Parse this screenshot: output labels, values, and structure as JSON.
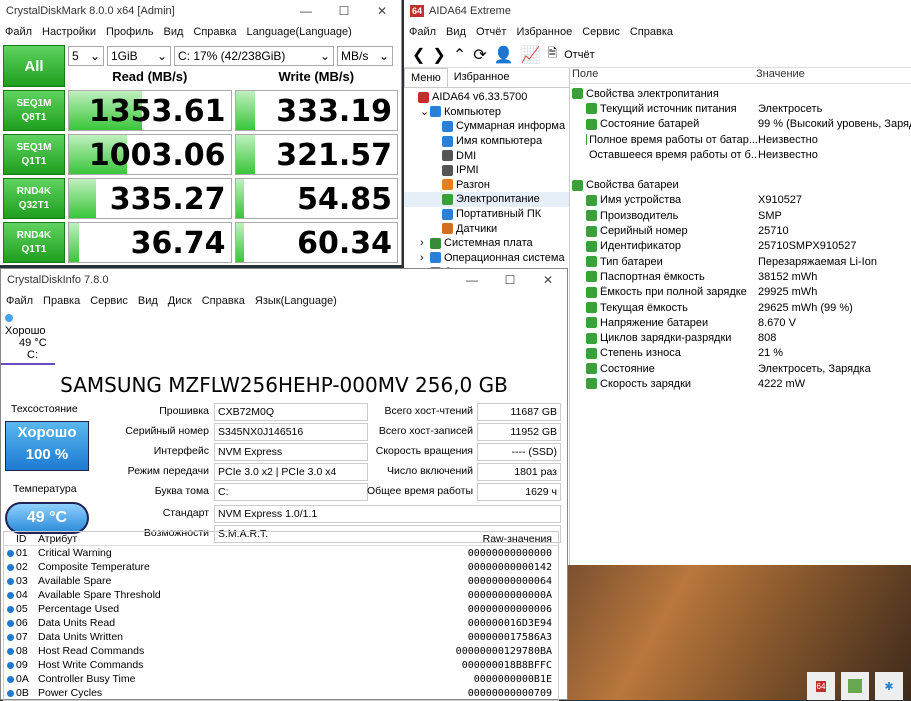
{
  "cdm": {
    "title": "CrystalDiskMark 8.0.0 x64 [Admin]",
    "menu": [
      "Файл",
      "Настройки",
      "Профиль",
      "Вид",
      "Справка",
      "Language(Language)"
    ],
    "all_label": "All",
    "count": "5",
    "size": "1GiB",
    "drive": "C: 17% (42/238GiB)",
    "unit": "MB/s",
    "read_header": "Read (MB/s)",
    "write_header": "Write (MB/s)",
    "tests": [
      {
        "l1": "SEQ1M",
        "l2": "Q8T1",
        "read": "1353.61",
        "write": "333.19",
        "read_fill": 0.45,
        "write_fill": 0.12
      },
      {
        "l1": "SEQ1M",
        "l2": "Q1T1",
        "read": "1003.06",
        "write": "321.57",
        "read_fill": 0.36,
        "write_fill": 0.12
      },
      {
        "l1": "RND4K",
        "l2": "Q32T1",
        "read": "335.27",
        "write": "54.85",
        "read_fill": 0.17,
        "write_fill": 0.05
      },
      {
        "l1": "RND4K",
        "l2": "Q1T1",
        "read": "36.74",
        "write": "60.34",
        "read_fill": 0.06,
        "write_fill": 0.05
      }
    ]
  },
  "aida": {
    "title": "AIDA64 Extreme",
    "menu": [
      "Файл",
      "Вид",
      "Отчёт",
      "Избранное",
      "Сервис",
      "Справка"
    ],
    "report_label": "Отчёт",
    "tabs": [
      "Меню",
      "Избранное"
    ],
    "tree": [
      {
        "label": "AIDA64 v6.33.5700",
        "indent": 0,
        "color": "#c0302a"
      },
      {
        "label": "Компьютер",
        "indent": 1,
        "color": "#2b7fd4"
      },
      {
        "label": "Суммарная информа",
        "indent": 2,
        "color": "#2b7fd4"
      },
      {
        "label": "Имя компьютера",
        "indent": 2,
        "color": "#2b7fd4"
      },
      {
        "label": "DMI",
        "indent": 2,
        "color": "#555"
      },
      {
        "label": "IPMI",
        "indent": 2,
        "color": "#555"
      },
      {
        "label": "Разгон",
        "indent": 2,
        "color": "#e08020"
      },
      {
        "label": "Электропитание",
        "indent": 2,
        "color": "#3aa03a"
      },
      {
        "label": "Портативный ПК",
        "indent": 2,
        "color": "#2b7fd4"
      },
      {
        "label": "Датчики",
        "indent": 2,
        "color": "#d07020"
      },
      {
        "label": "Системная плата",
        "indent": 1,
        "color": "#3a8a3a"
      },
      {
        "label": "Операционная система",
        "indent": 1,
        "color": "#2b7fd4"
      },
      {
        "label": "Сервер",
        "indent": 1,
        "color": "#777"
      }
    ],
    "col_field": "Поле",
    "col_value": "Значение",
    "power_section": "Свойства электропитания",
    "power_rows": [
      {
        "f": "Текущий источник питания",
        "v": "Электросеть"
      },
      {
        "f": "Состояние батарей",
        "v": "99 % (Высокий уровень, Зарядк"
      },
      {
        "f": "Полное время работы от батар...",
        "v": "Неизвестно"
      },
      {
        "f": "Оставшееся время работы от б...",
        "v": "Неизвестно"
      }
    ],
    "battery_section": "Свойства батареи",
    "battery_rows": [
      {
        "f": "Имя устройства",
        "v": "X910527"
      },
      {
        "f": "Производитель",
        "v": "SMP"
      },
      {
        "f": "Серийный номер",
        "v": "25710"
      },
      {
        "f": "Идентификатор",
        "v": "25710SMPX910527"
      },
      {
        "f": "Тип батареи",
        "v": "Перезаряжаемая Li-Ion"
      },
      {
        "f": "Паспортная ёмкость",
        "v": "38152 mWh"
      },
      {
        "f": "Ёмкость при полной зарядке",
        "v": "29925 mWh"
      },
      {
        "f": "Текущая ёмкость",
        "v": "29625 mWh  (99 %)"
      },
      {
        "f": "Напряжение батареи",
        "v": "8.670 V"
      },
      {
        "f": "Циклов зарядки-разрядки",
        "v": "808"
      },
      {
        "f": "Степень износа",
        "v": "21 %"
      },
      {
        "f": "Состояние",
        "v": "Электросеть, Зарядка"
      },
      {
        "f": "Скорость зарядки",
        "v": "4222 mW"
      }
    ]
  },
  "cdi": {
    "title": "CrystalDiskInfo 7.8.0",
    "menu": [
      "Файл",
      "Правка",
      "Сервис",
      "Вид",
      "Диск",
      "Справка",
      "Язык(Language)"
    ],
    "status_word": "Хорошо",
    "status_temp": "49 °C",
    "status_drive": "C:",
    "model": "SAMSUNG MZFLW256HEHP-000MV 256,0 GB",
    "health_label": "Техсостояние",
    "health_word": "Хорошо",
    "health_pct": "100 %",
    "temp_label": "Температура",
    "temp_value": "49 °C",
    "left_fields": [
      {
        "l": "Прошивка",
        "v": "CXB72M0Q"
      },
      {
        "l": "Серийный номер",
        "v": "S345NX0J146516"
      },
      {
        "l": "Интерфейс",
        "v": "NVM Express"
      },
      {
        "l": "Режим передачи",
        "v": "PCIe 3.0 x2 | PCIe 3.0 x4"
      },
      {
        "l": "Буква тома",
        "v": "C:"
      }
    ],
    "right_fields": [
      {
        "l": "Всего хост-чтений",
        "v": "11687 GB"
      },
      {
        "l": "Всего хост-записей",
        "v": "11952 GB"
      },
      {
        "l": "Скорость вращения",
        "v": "---- (SSD)"
      },
      {
        "l": "Число включений",
        "v": "1801 раз"
      },
      {
        "l": "Общее время работы",
        "v": "1629 ч"
      }
    ],
    "standard_label": "Стандарт",
    "standard_value": "NVM Express 1.0/1.1",
    "features_label": "Возможности",
    "features_value": "S.M.A.R.T.",
    "attr_headers": {
      "id": "ID",
      "name": "Атрибут",
      "raw": "Raw-значения"
    },
    "attrs": [
      {
        "id": "01",
        "name": "Critical Warning",
        "raw": "00000000000000"
      },
      {
        "id": "02",
        "name": "Composite Temperature",
        "raw": "00000000000142"
      },
      {
        "id": "03",
        "name": "Available Spare",
        "raw": "00000000000064"
      },
      {
        "id": "04",
        "name": "Available Spare Threshold",
        "raw": "0000000000000A"
      },
      {
        "id": "05",
        "name": "Percentage Used",
        "raw": "00000000000006"
      },
      {
        "id": "06",
        "name": "Data Units Read",
        "raw": "000000016D3E94"
      },
      {
        "id": "07",
        "name": "Data Units Written",
        "raw": "000000017586A3"
      },
      {
        "id": "08",
        "name": "Host Read Commands",
        "raw": "00000000129780BA"
      },
      {
        "id": "09",
        "name": "Host Write Commands",
        "raw": "000000018B8BFFC"
      },
      {
        "id": "0A",
        "name": "Controller Busy Time",
        "raw": "0000000000B1E"
      },
      {
        "id": "0B",
        "name": "Power Cycles",
        "raw": "00000000000709"
      }
    ]
  }
}
